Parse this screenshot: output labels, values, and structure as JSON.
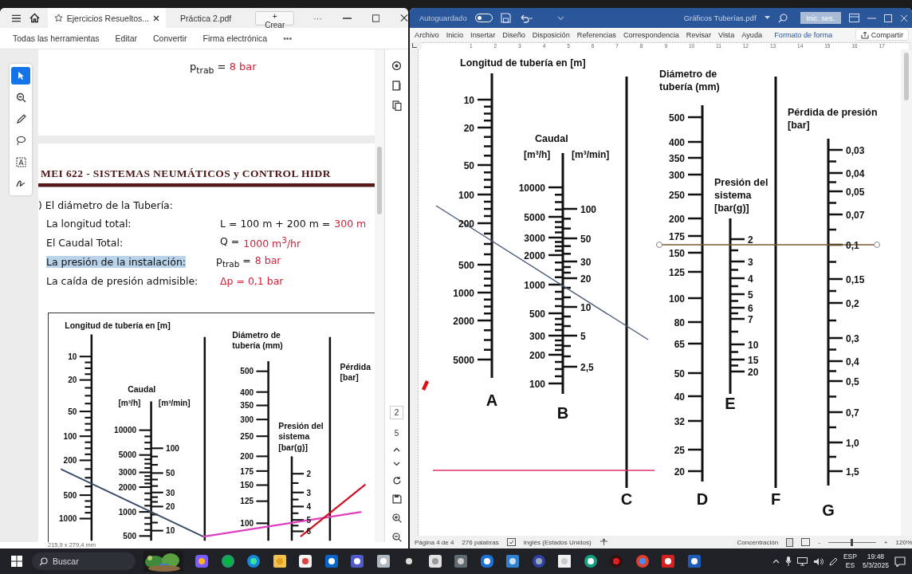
{
  "pdf_viewer": {
    "tabs": [
      {
        "label": "Ejercicios Resueltos...",
        "selected": true
      },
      {
        "label": "Práctica 2.pdf",
        "selected": false
      }
    ],
    "create_button": "+ Crear",
    "tabs_more": "···",
    "toolbar": [
      "Todas las herramientas",
      "Editar",
      "Convertir",
      "Firma electrónica"
    ],
    "toolbar_more": "•••",
    "tools": [
      {
        "selected": true
      },
      {
        "selected": false
      },
      {
        "selected": false
      },
      {
        "selected": false
      },
      {
        "selected": false
      },
      {
        "selected": false
      }
    ],
    "page1_formula": {
      "lhs": "p$_{trab}$ =",
      "value": "8 bar"
    },
    "heading": "MEI 622 - SISTEMAS NEUMÁTICOS y CONTROL HIDR",
    "intro": ") El diámetro de la Tubería:",
    "givens": [
      {
        "label": "La longitud total:",
        "expr": "L = 100 m + 200 m =",
        "value": "300 m",
        "highlighted": false
      },
      {
        "label": "El Caudal Total:",
        "expr": "Q =",
        "value": "1000 m$^{3}$/hr",
        "highlighted": false
      },
      {
        "label": "La presión de la instalación:",
        "expr": "p$_{trab}$ =",
        "value": "8 bar",
        "highlighted": true
      },
      {
        "label": "La caída de presión admisible:",
        "value": "Δp = 0,1 bar",
        "highlighted": false
      }
    ],
    "chart": {
      "length": {
        "title": "Longitud de tubería en [m]",
        "ticks": [
          "10",
          "20",
          "50",
          "100",
          "200",
          "500",
          "1000"
        ]
      },
      "flow": {
        "title": "Caudal",
        "unit_h": "[m³/h]",
        "unit_min": "[m³/min]",
        "ticks_h": [
          "10000",
          "5000",
          "3000",
          "2000",
          "1000",
          "500"
        ],
        "ticks_min": [
          "100",
          "50",
          "30",
          "20",
          "10"
        ]
      },
      "diameter": {
        "title": [
          "Diámetro de",
          "tubería  (mm)"
        ],
        "ticks": [
          "500",
          "400",
          "350",
          "300",
          "250",
          "200",
          "175",
          "150",
          "125",
          "100"
        ]
      },
      "pressure": {
        "title": [
          "Presión del",
          "sistema",
          "[bar(g)]"
        ],
        "ticks": [
          "2",
          "3",
          "4",
          "5",
          "6"
        ]
      },
      "loss": {
        "title": [
          "Pérdida",
          "[bar]"
        ]
      }
    },
    "page_nav": {
      "current": "2",
      "total": "5"
    },
    "paper_size": "215,9 x 279,4 mm"
  },
  "word": {
    "autosave": {
      "label": "Autoguardado",
      "on": false
    },
    "title": "Gráficos Tuberías.pdf",
    "sign_in": "Inic. ses.",
    "menu": [
      "Archivo",
      "Inicio",
      "Insertar",
      "Diseño",
      "Disposición",
      "Referencias",
      "Correspondencia",
      "Revisar",
      "Vista",
      "Ayuda",
      "Formato de forma"
    ],
    "share": "Compartir",
    "ruler": [
      "1",
      "2",
      "3",
      "4",
      "5",
      "6",
      "7",
      "8",
      "9",
      "10",
      "11",
      "12",
      "13",
      "14",
      "15",
      "16",
      "17"
    ],
    "chart": {
      "length": {
        "title": "Longitud de tubería en [m]",
        "ticks": [
          "10",
          "20",
          "50",
          "100",
          "200",
          "500",
          "1000",
          "2000",
          "5000"
        ],
        "letter": "A"
      },
      "flow": {
        "title": "Caudal",
        "unit_h": "[m³/h]",
        "unit_min": "[m³/min]",
        "ticks_h": [
          "10000",
          "5000",
          "3000",
          "2000",
          "1000",
          "500",
          "300",
          "200",
          "100"
        ],
        "ticks_min": [
          "100",
          "50",
          "30",
          "20",
          "10",
          "5",
          "2,5"
        ],
        "letter": "B"
      },
      "axis_c": {
        "letter": "C"
      },
      "diameter": {
        "title": [
          "Diámetro de",
          "tubería  (mm)"
        ],
        "ticks": [
          "500",
          "400",
          "350",
          "300",
          "250",
          "200",
          "175",
          "150",
          "125",
          "100",
          "80",
          "65",
          "50",
          "40",
          "32",
          "25",
          "20"
        ],
        "letter": "D"
      },
      "pressure": {
        "title": [
          "Presión del",
          "sistema",
          "[bar(g)]"
        ],
        "ticks": [
          "2",
          "3",
          "4",
          "5",
          "6",
          "7",
          "10",
          "15",
          "20"
        ],
        "letter": "E"
      },
      "axis_f": {
        "letter": "F"
      },
      "loss": {
        "title": [
          "Pérdida de presión",
          "[bar]"
        ],
        "ticks": [
          "0,03",
          "0,04",
          "0,05",
          "0,07",
          "0,1",
          "0,15",
          "0,2",
          "0,3",
          "0,4",
          "0,5",
          "0,7",
          "1,0",
          "1,5"
        ],
        "letter": "G"
      }
    },
    "status": {
      "page": "Página 4 de 4",
      "words": "276 palabras",
      "language": "Inglés (Estados Unidos)",
      "focus": "Concentración",
      "zoom_minus": "-",
      "zoom_plus": "+",
      "zoom": {
        "level": 0.5
      },
      "zoom_label": "120%"
    }
  },
  "taskbar": {
    "search": {
      "placeholder": "Buscar"
    },
    "lang": "ESP",
    "layout": "ES",
    "time": "19:48",
    "date": "5/3/2025"
  }
}
